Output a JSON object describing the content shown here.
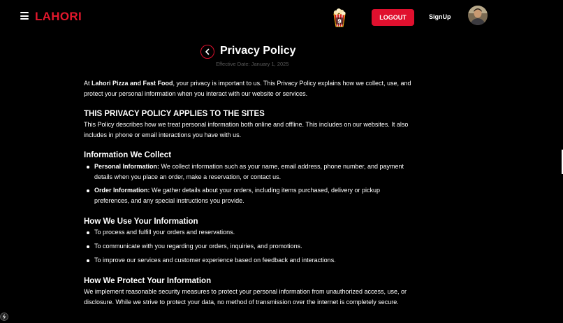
{
  "header": {
    "brand": "LAHORI",
    "cart_count": "9",
    "logout_label": "LOGOUT",
    "signup_label": "SignUp"
  },
  "page": {
    "title": "Privacy Policy",
    "effective_date": "Effective Date: January 1, 2025"
  },
  "intro": {
    "prefix": "At ",
    "company": "Lahori Pizza and Fast Food",
    "suffix": ", your privacy is important to us. This Privacy Policy explains how we collect, use, and protect your personal information when you interact with our website or services."
  },
  "sections": [
    {
      "heading": "THIS PRIVACY POLICY APPLIES TO THE SITES",
      "text": "This Policy describes how we treat personal information both online and offline. This includes on our websites. It also includes in phone or email interactions you have with us."
    },
    {
      "heading": "Information We Collect",
      "items": [
        {
          "label": "Personal Information:",
          "text": " We collect information such as your name, email address, phone number, and payment details when you place an order, make a reservation, or contact us."
        },
        {
          "label": "Order Information:",
          "text": " We gather details about your orders, including items purchased, delivery or pickup preferences, and any special instructions you provide."
        }
      ]
    },
    {
      "heading": "How We Use Your Information",
      "items": [
        "To process and fulfill your orders and reservations.",
        "To communicate with you regarding your orders, inquiries, and promotions.",
        "To improve our services and customer experience based on feedback and interactions."
      ]
    },
    {
      "heading": "How We Protect Your Information",
      "text": "We implement reasonable security measures to protect your personal information from unauthorized access, use, or disclosure. While we strive to protect your data, no method of transmission over the internet is completely secure."
    }
  ],
  "colors": {
    "accent": "#e0102e",
    "background": "#000000",
    "muted": "#5a5a5a"
  },
  "icons": {
    "menu": "hamburger-icon",
    "cart": "popcorn-cart-icon",
    "back": "chevron-left-icon",
    "avatar": "user-avatar"
  }
}
